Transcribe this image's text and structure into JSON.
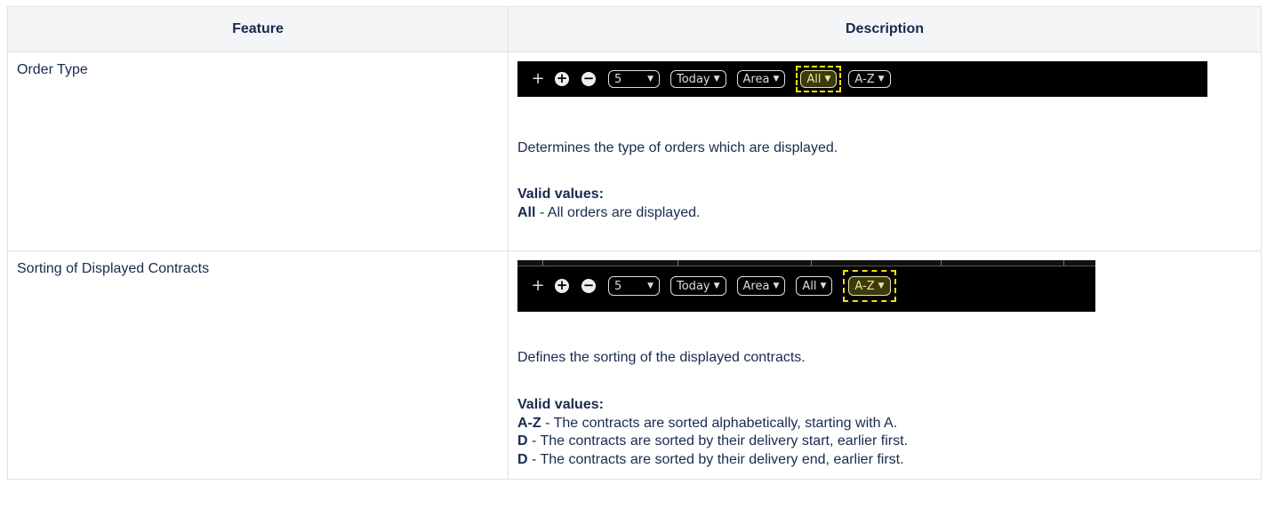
{
  "table": {
    "headers": [
      "Feature",
      "Description"
    ],
    "rows": [
      {
        "feature": "Order Type",
        "toolbar": {
          "plus": "+",
          "add": "+",
          "remove": "−",
          "count": "5",
          "period": "Today",
          "area": "Area",
          "orders": "All",
          "sort": "A-Z",
          "highlighted": "orders"
        },
        "description": "Determines the type of orders which are displayed.",
        "valid_label": "Valid values:",
        "values": [
          {
            "key": "All",
            "text": " - All orders are displayed."
          }
        ]
      },
      {
        "feature": "Sorting of Displayed Contracts",
        "toolbar": {
          "plus": "+",
          "add": "+",
          "remove": "−",
          "count": "5",
          "period": "Today",
          "area": "Area",
          "orders": "All",
          "sort": "A-Z",
          "highlighted": "sort"
        },
        "description": "Defines the sorting of the displayed contracts.",
        "valid_label": "Valid values:",
        "values": [
          {
            "key": "A-Z",
            "text": " - The contracts are sorted alphabetically, starting with A."
          },
          {
            "key": "D",
            "text": " - The contracts are sorted by their delivery start, earlier first."
          },
          {
            "key": "D",
            "text": " - The contracts are sorted by their delivery end, earlier first."
          }
        ]
      }
    ]
  },
  "colors": {
    "header_bg": "#f4f5f7",
    "border": "#dfe1e6",
    "highlight": "#f5e300"
  }
}
